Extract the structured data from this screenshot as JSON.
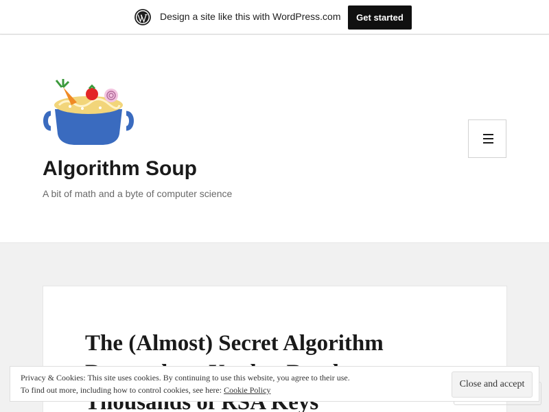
{
  "wp_bar": {
    "text": "Design a site like this with WordPress.com",
    "cta_label": "Get started"
  },
  "header": {
    "site_title": "Algorithm Soup",
    "tagline": "A bit of math and a byte of computer science"
  },
  "post": {
    "title": "The (Almost) Secret Algorithm Researchers Used to Break Thousands of RSA Keys"
  },
  "cookie_banner": {
    "line1": "Privacy & Cookies: This site uses cookies. By continuing to use this website, you agree to their use.",
    "line2_prefix": "To find out more, including how to control cookies, see here: ",
    "policy_link": "Cookie Policy",
    "accept_label": "Close and accept"
  },
  "colors": {
    "accent_dark": "#101010",
    "pot_blue": "#3a6bbf"
  },
  "icons": {
    "wordpress": "wordpress-logo-icon",
    "menu": "hamburger-menu-icon",
    "logo": "soup-pot-icon"
  }
}
